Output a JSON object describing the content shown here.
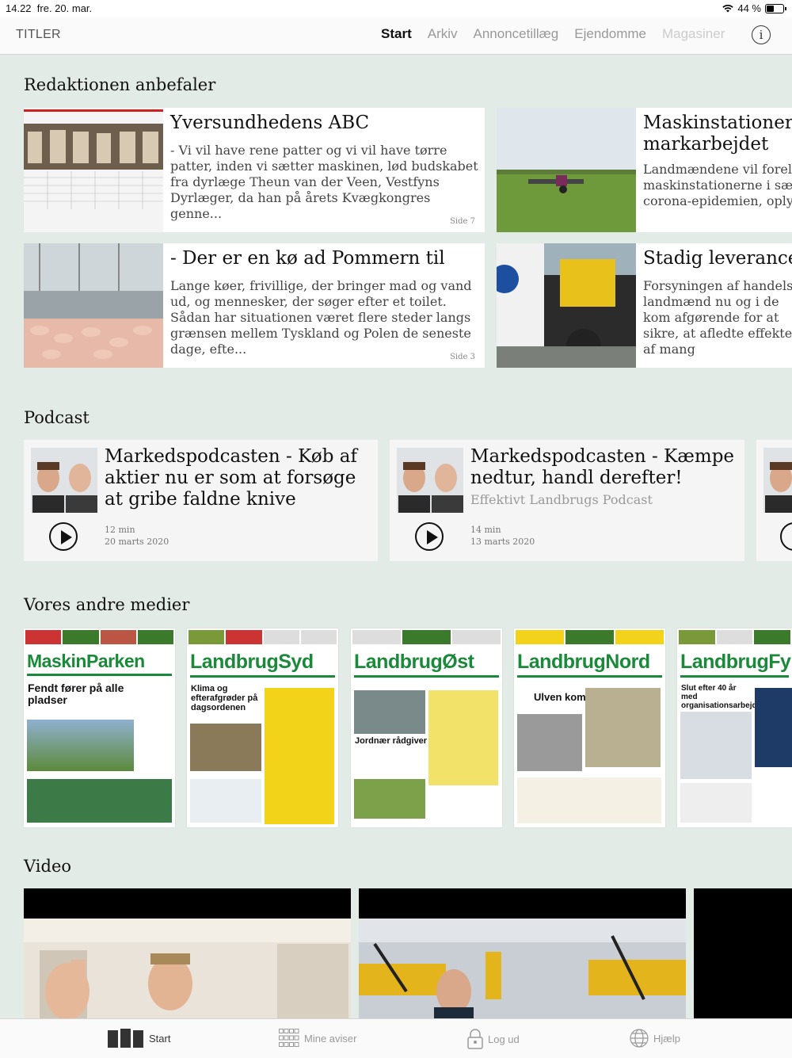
{
  "status": {
    "time": "14.22",
    "date": "fre. 20. mar.",
    "battery": "44 %"
  },
  "topnav": {
    "left_label": "TITLER",
    "tabs": [
      "Start",
      "Arkiv",
      "Annoncetillæg",
      "Ejendomme",
      "Magasiner"
    ],
    "active_tab": "Start"
  },
  "recommended": {
    "title": "Redaktionen anbefaler",
    "cards": [
      {
        "title": "Yversundhedens ABC",
        "desc": "- Vi vil have rene patter og vi vil have tørre patter, inden vi sætter maskinen, lød budskabet fra dyrlæge Theun van der Veen, Vestfyns Dyrlæger, da han på årets Kvægkongres genne...",
        "page": "Side 7"
      },
      {
        "title": "Maskinstationer e",
        "title2": "markarbejdet",
        "desc": "Landmændene vil forelø maskinstationerne i sæd corona-epidemien, oply"
      },
      {
        "title": "- Der er en kø ad Pommern til",
        "desc": "Lange køer, frivillige, der bringer mad og vand ud, og mennesker, der søger efter et toilet. Sådan har situationen været flere steder langs grænsen mellem Tyskland og Polen de seneste dage, efte...",
        "page": "Side 3"
      },
      {
        "title": "Stadig leverancer",
        "desc": "Forsyningen af handelsg landmænd nu og i de kom afgørende for at sikre, at afledte effekter af mang"
      }
    ]
  },
  "podcast": {
    "title": "Podcast",
    "items": [
      {
        "title": "Markedspodcasten - Køb af aktier nu er som at forsøge at gribe faldne knive",
        "subtitle": "",
        "duration": "12 min",
        "date": "20 marts 2020"
      },
      {
        "title": "Markedspodcasten - Kæmpe nedtur, handl derefter!",
        "subtitle": "Effektivt Landbrugs Podcast",
        "duration": "14 min",
        "date": "13 marts 2020"
      }
    ]
  },
  "media": {
    "title": "Vores andre medier",
    "papers": [
      {
        "name": "MaskinParken",
        "headline": "Fendt fører på alle pladser",
        "color": "#1a8a3a"
      },
      {
        "name": "LandbrugSyd",
        "headline": "Klima og efterafgrøder på dagsordenen",
        "color": "#1a8a3a"
      },
      {
        "name": "LandbrugØst",
        "headline": "Jordnær rådgiver",
        "color": "#1a8a3a"
      },
      {
        "name": "LandbrugNord",
        "headline": "Ulven kommer",
        "color": "#1a8a3a"
      },
      {
        "name": "LandbrugFy",
        "headline": "Slut efter 40 år med organisationsarbejde",
        "color": "#1a8a3a"
      }
    ]
  },
  "video": {
    "title": "Video"
  },
  "bottombar": {
    "items": [
      "Start",
      "Mine aviser",
      "Log ud",
      "Hjælp"
    ]
  }
}
